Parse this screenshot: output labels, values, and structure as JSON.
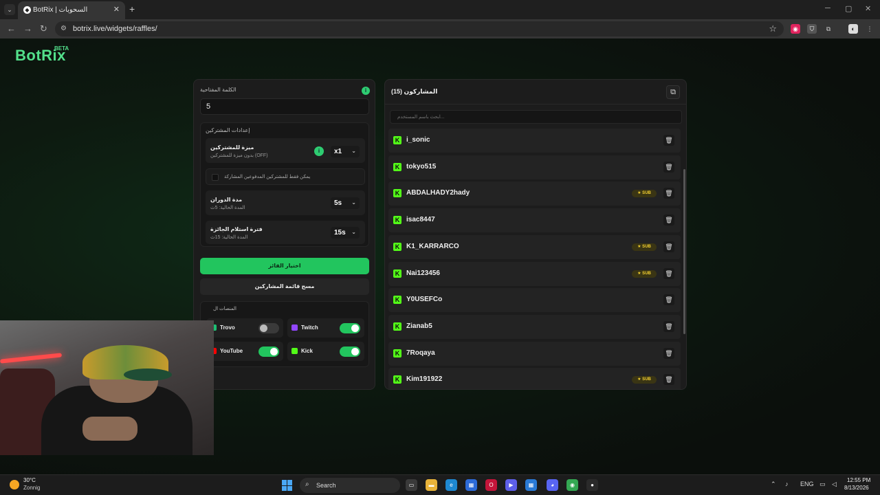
{
  "browser": {
    "tab_title": "BotRix | السحوبات",
    "url": "botrix.live/widgets/raffles/"
  },
  "header": {
    "logo": "BotRix",
    "beta": "BETA"
  },
  "left": {
    "keyword_label": "الكلمة المفتاحية",
    "keyword_value": "5",
    "settings_title": "إعدادات المشتركين",
    "sub_bonus_label": "ميزة للمشتركين",
    "sub_bonus_sub": "بدون ميزة للمشتركين (OFF)",
    "sub_bonus_value": "x1",
    "subs_only_label": "يمكن فقط للمشتركين المدفوعين المشاركة",
    "roll_duration_label": "مدة الدوران",
    "roll_duration_sub": "المدة الحالية: 5ث",
    "roll_duration_value": "5s",
    "claim_time_label": "فترة استلام الجائزة",
    "claim_time_sub": "المدة الحالية: 15ث",
    "claim_time_value": "15s",
    "pick_winner": "اختيار الفائز",
    "clear_list": "مسح قائمة المشاركين",
    "platforms_title": "المنصات ال",
    "platforms": [
      {
        "name": "Trovo",
        "on": false,
        "color": "#1dbf73"
      },
      {
        "name": "Twitch",
        "on": true,
        "color": "#9146ff"
      },
      {
        "name": "YouTube",
        "on": true,
        "color": "#ff0000"
      },
      {
        "name": "Kick",
        "on": true,
        "color": "#53fc18"
      }
    ]
  },
  "right": {
    "title": "المشاركون (15)",
    "search_placeholder": "ابحث باسم المستخدم...",
    "participants": [
      {
        "name": "i_sonic",
        "sub": false
      },
      {
        "name": "tokyo515",
        "sub": false
      },
      {
        "name": "ABDALHADY2hady",
        "sub": true
      },
      {
        "name": "isac8447",
        "sub": false
      },
      {
        "name": "K1_KARRARCO",
        "sub": true
      },
      {
        "name": "Nai123456",
        "sub": true
      },
      {
        "name": "Y0USEFCo",
        "sub": false
      },
      {
        "name": "Zianab5",
        "sub": false
      },
      {
        "name": "7Roqaya",
        "sub": false
      },
      {
        "name": "Kim191922",
        "sub": true
      }
    ],
    "sub_label": "★ SUB"
  },
  "taskbar": {
    "temp": "30°C",
    "condition": "Zonnig",
    "search": "Search",
    "lang": "ENG",
    "time": "12:55 PM",
    "date": "8/13/2026"
  }
}
